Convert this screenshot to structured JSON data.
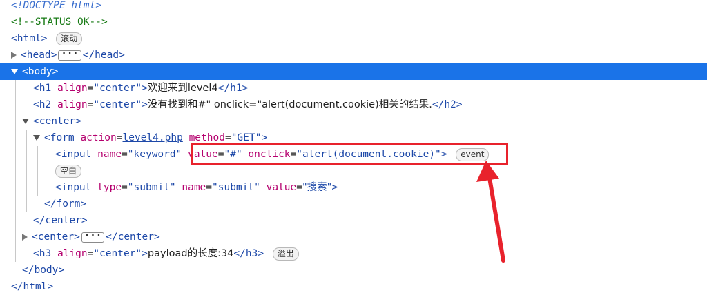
{
  "dom": {
    "doctype": "<!DOCTYPE html>",
    "comment": "<!--STATUS OK-->",
    "html_open": "<html>",
    "html_badge": "滚动",
    "head_open": "<head>",
    "head_close": "</head>",
    "body_open": "<body>",
    "h1": {
      "open": "<h1",
      "attr": "align",
      "value": "\"center\"",
      "close_br": ">",
      "text": "欢迎来到level4",
      "end": "</h1>"
    },
    "h2": {
      "open": "<h2",
      "attr": "align",
      "value": "\"center\"",
      "close_br": ">",
      "text": "没有找到和#\" onclick=\"alert(document.cookie)相关的结果.",
      "end": "</h2>"
    },
    "center_open": "<center>",
    "form": {
      "open": "<form",
      "attr1": "action",
      "eq": "=",
      "value1": "level4.php",
      "attr2": "method",
      "value2": "\"GET\"",
      "close_br": ">"
    },
    "input1": {
      "open": "<input",
      "attr1": "name",
      "value1": "\"keyword\"",
      "attr2": "value",
      "value2": "\"#\"",
      "attr3": "onclick",
      "value3": "\"alert(document.cookie)\"",
      "close_br": ">",
      "badge": "event"
    },
    "whitespace_badge": "空白",
    "input2": {
      "open": "<input",
      "attr1": "type",
      "value1": "\"submit\"",
      "attr2": "name",
      "value2": "\"submit\"",
      "attr3": "value",
      "value3": "\"搜索\"",
      "close_br": ">"
    },
    "form_close": "</form>",
    "center_close": "</center>",
    "center2_open": "<center>",
    "center2_close": "</center>",
    "h3": {
      "open": "<h3",
      "attr": "align",
      "value": "\"center\"",
      "close_br": ">",
      "text": "payload的长度:34",
      "end": "</h3>",
      "badge": "溢出"
    },
    "body_close": "</body>",
    "html_close": "</html>"
  },
  "colors": {
    "selection": "#1a73e8",
    "annotation_red": "#e8222c",
    "tag": "#1d48a8",
    "attribute": "#b5006e",
    "comment": "#177a14"
  }
}
